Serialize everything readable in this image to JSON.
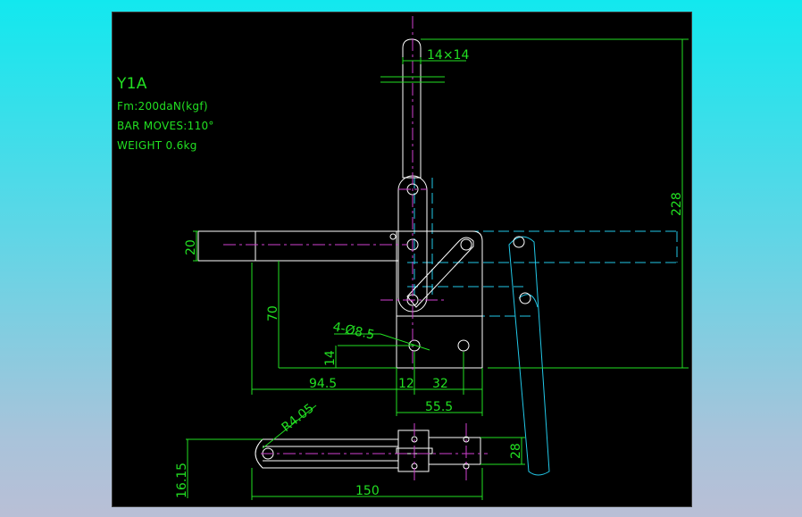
{
  "clamp": {
    "model": "Y1A",
    "force": "Fm:200daN(kgf)",
    "bar_moves": "BAR MOVES:110°",
    "weight": "WEIGHT 0.6kg"
  },
  "dimensions": {
    "bar_section": "14×14",
    "height": "228",
    "bar_width": "20",
    "base_height": "70",
    "hole_spec": "4-Ø8.5",
    "hole_offset": "14",
    "reach": "94.5",
    "hole_x1": "12",
    "hole_pitch": "32",
    "base_width": "55.5",
    "radius": "R4.05",
    "top_width": "28",
    "top_offset": "16.15",
    "overall_length": "150"
  },
  "colors": {
    "background": "#000000",
    "outline": "#ffffff",
    "dimension": "#22e022",
    "centerline": "#d040d0",
    "phantom": "#22c8e8"
  }
}
